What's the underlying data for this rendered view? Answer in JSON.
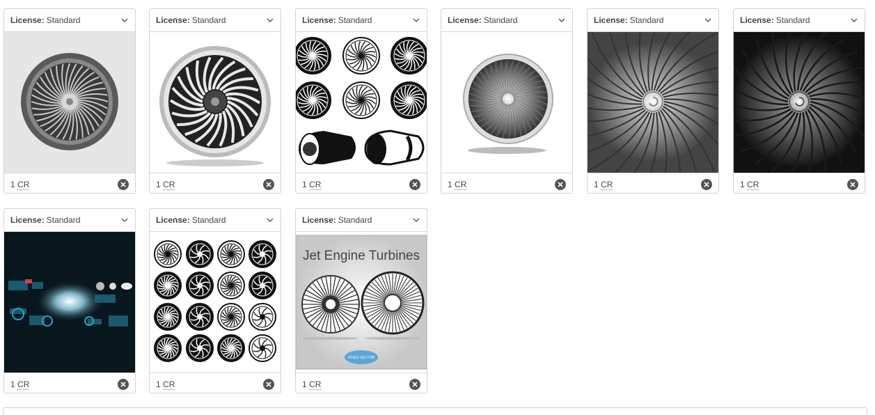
{
  "cards": [
    {
      "license_label": "License:",
      "license_value": "Standard",
      "price": "1",
      "price_unit": "CR",
      "image": "jet-engine-front-gray"
    },
    {
      "license_label": "License:",
      "license_value": "Standard",
      "price": "1",
      "price_unit": "CR",
      "image": "jet-engine-front-curved-blades"
    },
    {
      "license_label": "License:",
      "license_value": "Standard",
      "price": "1",
      "price_unit": "CR",
      "image": "turbine-icon-set-black"
    },
    {
      "license_label": "License:",
      "license_value": "Standard",
      "price": "1",
      "price_unit": "CR",
      "image": "jet-engine-front-soft"
    },
    {
      "license_label": "License:",
      "license_value": "Standard",
      "price": "1",
      "price_unit": "CR",
      "image": "turbine-blades-closeup-gray"
    },
    {
      "license_label": "License:",
      "license_value": "Standard",
      "price": "1",
      "price_unit": "CR",
      "image": "turbine-blades-closeup-dark"
    },
    {
      "license_label": "License:",
      "license_value": "Standard",
      "price": "1",
      "price_unit": "CR",
      "image": "hud-jet-engine-infographic"
    },
    {
      "license_label": "License:",
      "license_value": "Standard",
      "price": "1",
      "price_unit": "CR",
      "image": "turbine-icon-grid"
    },
    {
      "license_label": "License:",
      "license_value": "Standard",
      "price": "1",
      "price_unit": "CR",
      "image": "jet-engine-turbines-poster",
      "poster_title": "Jet Engine Turbines",
      "poster_badge": "EPS10 VECTOR"
    }
  ],
  "colors": {
    "border": "#d2d2d2",
    "remove_button": "#555555",
    "text": "#444444"
  }
}
